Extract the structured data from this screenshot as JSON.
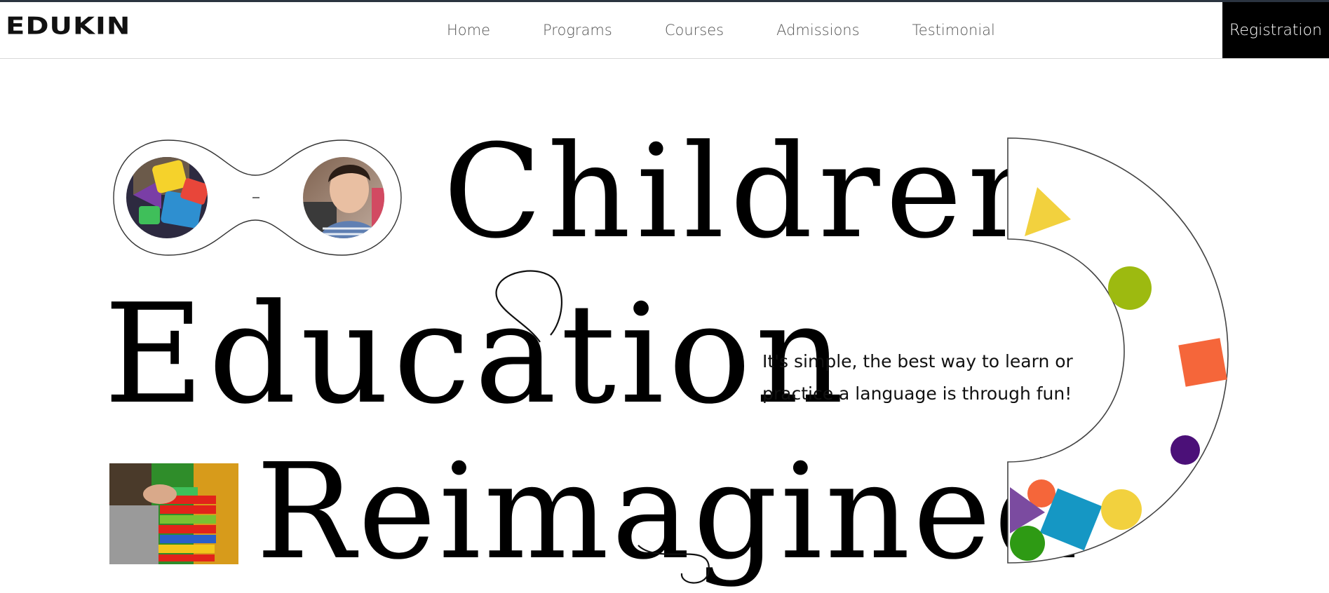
{
  "brand": {
    "logo_text": "EDUKIN"
  },
  "nav": {
    "items": [
      {
        "label": "Home"
      },
      {
        "label": "Programs"
      },
      {
        "label": "Courses"
      },
      {
        "label": "Admissions"
      },
      {
        "label": "Testimonial"
      }
    ],
    "cta_label": "Registration"
  },
  "hero": {
    "headline": {
      "line1": "Children",
      "line2": "Education",
      "line3": "Reimagined"
    },
    "tagline": "It's simple, the best way to learn or practice a language is through fun!",
    "images": {
      "left_photo": "toy-letters-photo",
      "right_photo": "smiling-boy-photo",
      "blocks_photo": "stacking-blocks-photo"
    }
  },
  "colors": {
    "header_border": "#d8d8d8",
    "cta_background": "#000000",
    "yellow": "#f2d13e",
    "lime": "#9dba10",
    "orange": "#f5663a",
    "purple": "#4b1078",
    "lavender": "#7b4ba0",
    "blue": "#1597c4",
    "green": "#2e9a14"
  }
}
